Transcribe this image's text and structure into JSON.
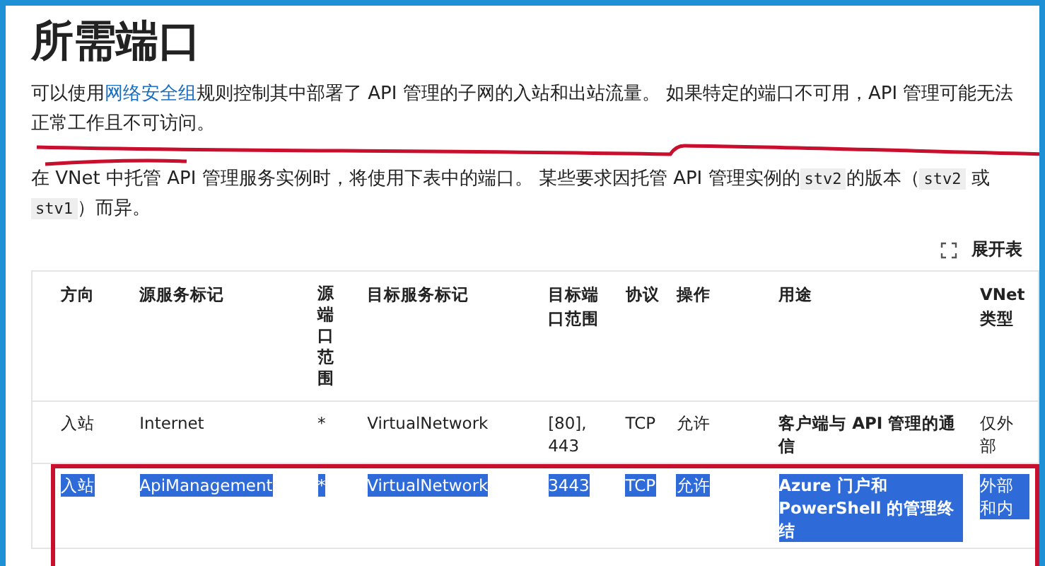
{
  "title": "所需端口",
  "paragraphs": [
    {
      "segments": [
        {
          "kind": "text",
          "text": "可以使用"
        },
        {
          "kind": "link",
          "text": "网络安全组"
        },
        {
          "kind": "text",
          "text": "规则控制其中部署了 API 管理的子网的入站和出站流量。 如果特定的端口不可用，API 管理可能无法正常工作且不可访问。"
        }
      ]
    },
    {
      "segments": [
        {
          "kind": "text",
          "text": "在 VNet 中托管 API 管理服务实例时，将使用下表中的端口。 某些要求因托管 API 管理实例的"
        },
        {
          "kind": "code",
          "text": "stv2"
        },
        {
          "kind": "text",
          "text": "的版本（"
        },
        {
          "kind": "code",
          "text": "stv2"
        },
        {
          "kind": "text",
          "text": " 或 "
        },
        {
          "kind": "code",
          "text": "stv1"
        },
        {
          "kind": "text",
          "text": "）而异。"
        }
      ]
    }
  ],
  "table": {
    "expand_button": "展开表",
    "columns": [
      "方向",
      "源服务标记",
      "源端口范围",
      "目标服务标记",
      "目标端口范围",
      "协议",
      "操作",
      "用途",
      "VNet 类型"
    ],
    "rows": [
      {
        "selected": false,
        "cells": [
          "入站",
          "Internet",
          "*",
          "VirtualNetwork",
          "[80], 443",
          "TCP",
          "允许",
          "客户端与 API 管理的通信",
          "仅外部"
        ]
      },
      {
        "selected": true,
        "cells": [
          "入站",
          "ApiManagement",
          "*",
          "VirtualNetwork",
          "3443",
          "TCP",
          "允许",
          "Azure 门户和 PowerShell 的管理终结",
          "外部和内"
        ]
      }
    ]
  }
}
